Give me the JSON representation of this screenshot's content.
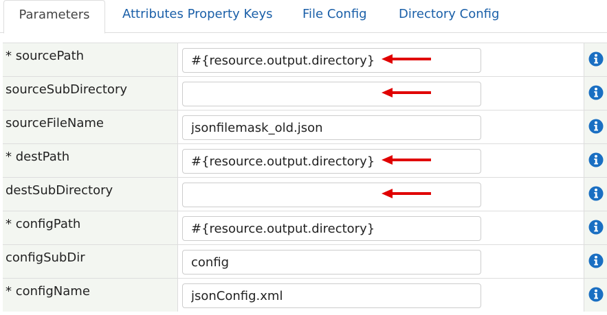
{
  "tabs": [
    {
      "label": "Parameters",
      "active": true
    },
    {
      "label": "Attributes Property Keys",
      "active": false
    },
    {
      "label": "File Config",
      "active": false
    },
    {
      "label": "Directory Config",
      "active": false
    }
  ],
  "rows": [
    {
      "label": "* sourcePath",
      "value": "#{resource.output.directory}",
      "arrow": true
    },
    {
      "label": "sourceSubDirectory",
      "value": "",
      "arrow": true
    },
    {
      "label": "sourceFileName",
      "value": "jsonfilemask_old.json",
      "arrow": false
    },
    {
      "label": "* destPath",
      "value": "#{resource.output.directory}",
      "arrow": true
    },
    {
      "label": "destSubDirectory",
      "value": "",
      "arrow": true
    },
    {
      "label": "* configPath",
      "value": "#{resource.output.directory}",
      "arrow": false
    },
    {
      "label": "configSubDir",
      "value": "config",
      "arrow": false
    },
    {
      "label": "* configName",
      "value": "jsonConfig.xml",
      "arrow": false
    }
  ],
  "icons": {
    "info": "info-icon",
    "annotation": "red-arrow-icon"
  },
  "colors": {
    "tab_link": "#1a5fa8",
    "info_icon": "#1a6fc2",
    "arrow": "#e00000",
    "label_bg": "#f3f6f1"
  }
}
